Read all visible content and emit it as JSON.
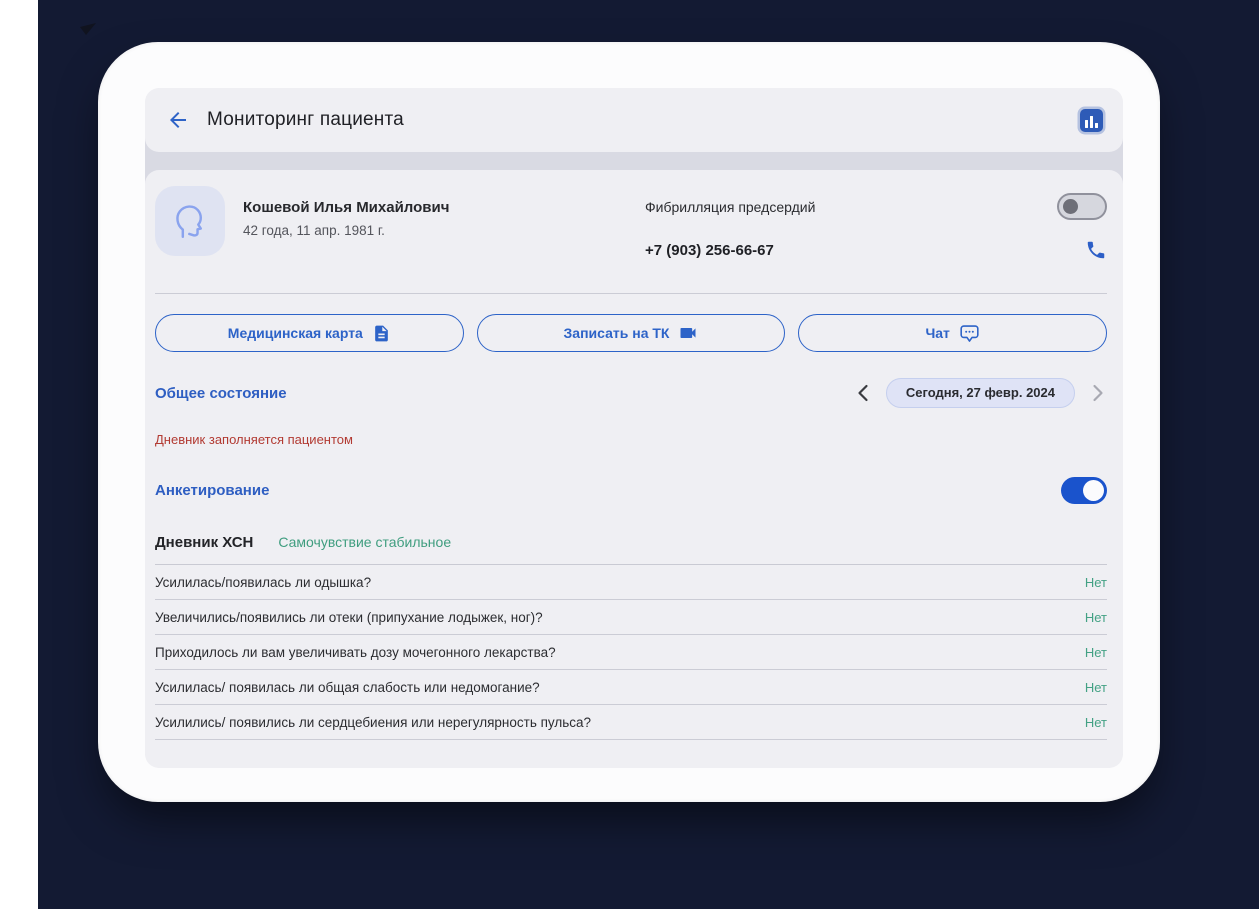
{
  "header": {
    "title": "Мониторинг пациента"
  },
  "patient": {
    "name": "Кошевой Илья Михайлович",
    "age_birth": "42 года, 11 апр. 1981 г.",
    "diagnosis": "Фибрилляция предсердий",
    "diagnosis_toggle_on": false,
    "phone": "+7 (903) 256-66-67"
  },
  "actions": [
    {
      "label": "Медицинская карта",
      "icon": "document-icon"
    },
    {
      "label": "Записать на ТК",
      "icon": "video-camera-icon"
    },
    {
      "label": "Чат",
      "icon": "chat-bubble-icon"
    }
  ],
  "general_state": {
    "title": "Общее состояние",
    "date_label": "Сегодня, 27 февр. 2024",
    "note": "Дневник заполняется пациентом"
  },
  "survey": {
    "title": "Анкетирование",
    "toggle_on": true
  },
  "diary": {
    "title": "Дневник ХСН",
    "status": "Самочувствие стабильное",
    "questions": [
      {
        "text": "Усилилась/появилась ли одышка?",
        "answer": "Нет"
      },
      {
        "text": "Увеличились/появились ли отеки (припухание лодыжек, ног)?",
        "answer": "Нет"
      },
      {
        "text": "Приходилось ли вам увеличивать дозу мочегонного лекарства?",
        "answer": "Нет"
      },
      {
        "text": "Усилилась/ появилась ли общая слабость или недомогание?",
        "answer": "Нет"
      },
      {
        "text": "Усилились/ появились ли сердцебиения или нерегулярность пульса?",
        "answer": "Нет"
      }
    ]
  },
  "colors": {
    "accent_blue": "#2d63c8",
    "toggle_on_blue": "#1a53cc",
    "alert_red": "#b23a32",
    "status_green": "#3f9d7f",
    "backdrop_navy": "#131a33",
    "screen_gray": "#efeff3"
  }
}
